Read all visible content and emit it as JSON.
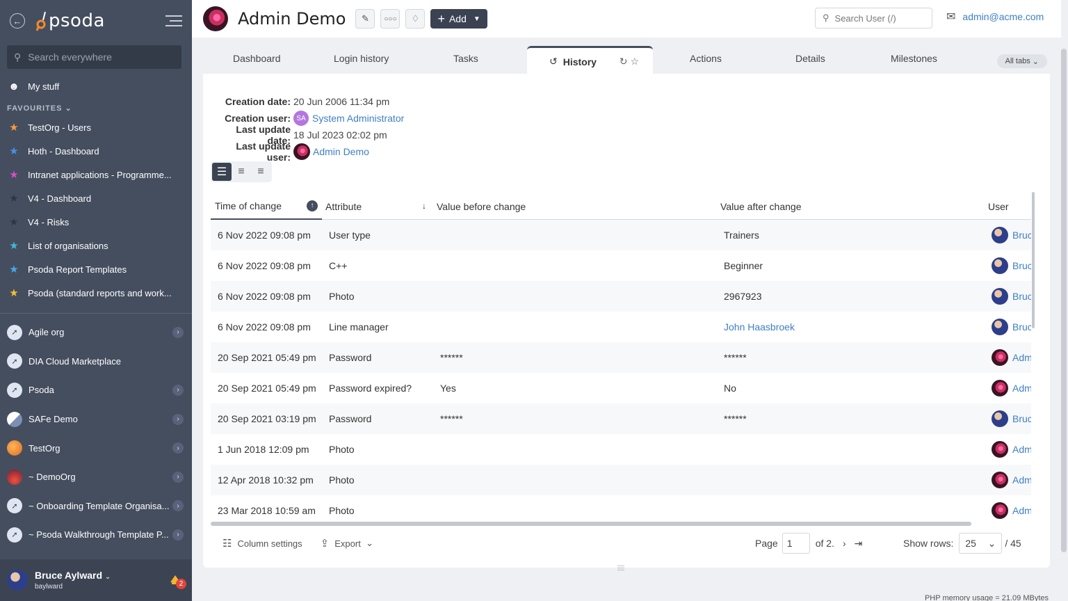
{
  "sidebar": {
    "logo": "psoda",
    "search_placeholder": "Search everywhere",
    "my_stuff": "My stuff",
    "favourites_title": "FAVOURITES",
    "favourites": [
      {
        "label": "TestOrg - Users",
        "star_color": "#f59a3b"
      },
      {
        "label": "Hoth - Dashboard",
        "star_color": "#4a8fe8"
      },
      {
        "label": "Intranet applications - Programme...",
        "star_color": "#d44fc8"
      },
      {
        "label": "V4 - Dashboard",
        "star_color": "#2f3542"
      },
      {
        "label": "V4 - Risks",
        "star_color": "#2f3542"
      },
      {
        "label": "List of organisations",
        "star_color": "#3fb9d9"
      },
      {
        "label": "Psoda Report Templates",
        "star_color": "#4aa8e8"
      },
      {
        "label": "Psoda (standard reports and work...",
        "star_color": "#f2c12e"
      }
    ],
    "orgs": [
      {
        "label": "Agile org",
        "has_arrow": true
      },
      {
        "label": "DIA Cloud Marketplace",
        "has_arrow": false
      },
      {
        "label": "Psoda",
        "has_arrow": true
      },
      {
        "label": "SAFe Demo",
        "has_arrow": true
      },
      {
        "label": "TestOrg",
        "has_arrow": true
      },
      {
        "label": "~ DemoOrg",
        "has_arrow": true
      },
      {
        "label": "~ Onboarding Template Organisa...",
        "has_arrow": true
      },
      {
        "label": "~ Psoda Walkthrough Template P...",
        "has_arrow": true
      }
    ],
    "user": {
      "name": "Bruce Aylward",
      "login": "baylward",
      "notifications": "2"
    }
  },
  "header": {
    "title": "Admin Demo",
    "add_label": "Add",
    "search_placeholder": "Search User (/)",
    "email": "admin@acme.com"
  },
  "tabs": {
    "items": [
      "Dashboard",
      "Login history",
      "Tasks",
      "History",
      "Actions",
      "Details",
      "Milestones"
    ],
    "active": "History",
    "all_tabs": "All tabs"
  },
  "meta": {
    "creation_date_label": "Creation date:",
    "creation_date": "20 Jun 2006 11:34 pm",
    "creation_user_label": "Creation user:",
    "creation_user_initials": "SA",
    "creation_user": "System Administrator",
    "last_update_date_label": "Last update date:",
    "last_update_date": "18 Jul 2023 02:02 pm",
    "last_update_user_label": "Last update user:",
    "last_update_user": "Admin Demo"
  },
  "table": {
    "columns": [
      "Time of change",
      "Attribute",
      "Value before change",
      "Value after change",
      "User"
    ],
    "rows": [
      {
        "time": "6 Nov 2022 09:08 pm",
        "attribute": "User type",
        "before": "",
        "after": "Trainers",
        "after_link": false,
        "user": "Bruce Aylward",
        "user_avatar": "bruce"
      },
      {
        "time": "6 Nov 2022 09:08 pm",
        "attribute": "C++",
        "before": "",
        "after": "Beginner",
        "after_link": false,
        "user": "Bruce Aylward",
        "user_avatar": "bruce"
      },
      {
        "time": "6 Nov 2022 09:08 pm",
        "attribute": "Photo",
        "before": "",
        "after": "2967923",
        "after_link": false,
        "user": "Bruce Aylward",
        "user_avatar": "bruce"
      },
      {
        "time": "6 Nov 2022 09:08 pm",
        "attribute": "Line manager",
        "before": "",
        "after": "John Haasbroek",
        "after_link": true,
        "user": "Bruce Aylward",
        "user_avatar": "bruce"
      },
      {
        "time": "20 Sep 2021 05:49 pm",
        "attribute": "Password",
        "before": "******",
        "after": "******",
        "after_link": false,
        "user": "Admin Demo",
        "user_avatar": "admin"
      },
      {
        "time": "20 Sep 2021 05:49 pm",
        "attribute": "Password expired?",
        "before": "Yes",
        "after": "No",
        "after_link": false,
        "user": "Admin Demo",
        "user_avatar": "admin"
      },
      {
        "time": "20 Sep 2021 03:19 pm",
        "attribute": "Password",
        "before": "******",
        "after": "******",
        "after_link": false,
        "user": "Bruce Aylward",
        "user_avatar": "bruce"
      },
      {
        "time": "1 Jun 2018 12:09 pm",
        "attribute": "Photo",
        "before": "",
        "after": "",
        "after_link": false,
        "user": "Admin Demo",
        "user_avatar": "admin"
      },
      {
        "time": "12 Apr 2018 10:32 pm",
        "attribute": "Photo",
        "before": "",
        "after": "",
        "after_link": false,
        "user": "Admin Demo",
        "user_avatar": "admin"
      },
      {
        "time": "23 Mar 2018 10:59 am",
        "attribute": "Photo",
        "before": "",
        "after": "",
        "after_link": false,
        "user": "Admin Demo",
        "user_avatar": "admin"
      }
    ]
  },
  "footer": {
    "column_settings": "Column settings",
    "export": "Export",
    "page_label": "Page",
    "page_value": "1",
    "of_pages": "of 2.",
    "show_rows_label": "Show rows:",
    "rows_value": "25",
    "total": "/ 45",
    "memory": "PHP memory usage = 21.09 MBytes"
  },
  "colors": {
    "sidebar_bg": "#454e5f",
    "link": "#3d7fc7",
    "accent_dark": "#3b4352"
  }
}
